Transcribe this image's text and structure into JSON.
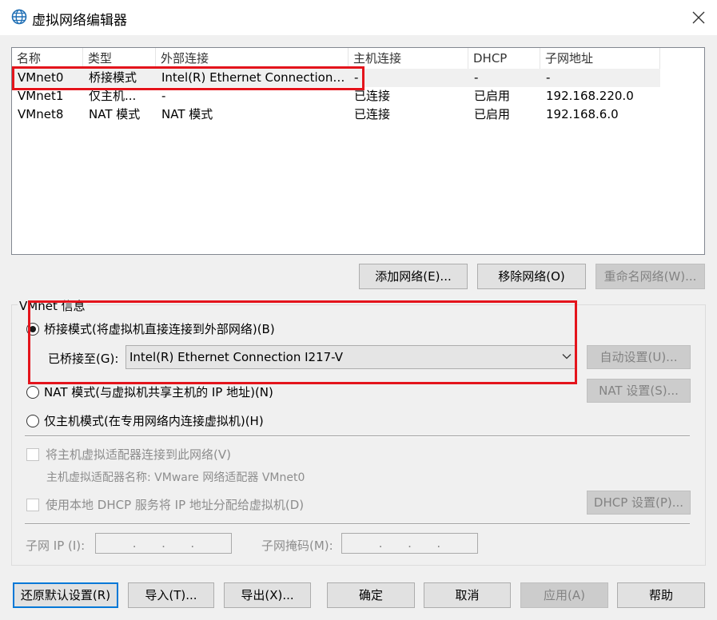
{
  "window": {
    "title": "虚拟网络编辑器"
  },
  "table": {
    "headers": [
      "名称",
      "类型",
      "外部连接",
      "主机连接",
      "DHCP",
      "子网地址"
    ],
    "rows": [
      [
        "VMnet0",
        "桥接模式",
        "Intel(R) Ethernet Connection I...",
        "-",
        "-",
        "-"
      ],
      [
        "VMnet1",
        "仅主机...",
        "-",
        "已连接",
        "已启用",
        "192.168.220.0"
      ],
      [
        "VMnet8",
        "NAT 模式",
        "NAT 模式",
        "已连接",
        "已启用",
        "192.168.6.0"
      ]
    ]
  },
  "network_buttons": {
    "add": "添加网络(E)...",
    "remove": "移除网络(O)",
    "rename": "重命名网络(W)..."
  },
  "vmnet_info": {
    "group_label": "VMnet 信息",
    "bridged_label": "桥接模式(将虚拟机直接连接到外部网络)(B)",
    "bridged_to_label": "已桥接至(G):",
    "bridged_to_value": "Intel(R) Ethernet Connection I217-V",
    "auto_settings": "自动设置(U)...",
    "nat_label": "NAT 模式(与虚拟机共享主机的 IP 地址)(N)",
    "nat_settings": "NAT 设置(S)...",
    "hostonly_label": "仅主机模式(在专用网络内连接虚拟机)(H)",
    "connect_adapter_label": "将主机虚拟适配器连接到此网络(V)",
    "adapter_name_label": "主机虚拟适配器名称: VMware 网络适配器 VMnet0",
    "dhcp_label": "使用本地 DHCP 服务将 IP 地址分配给虚拟机(D)",
    "dhcp_settings": "DHCP 设置(P)...",
    "subnet_ip_label": "子网 IP (I):",
    "subnet_mask_label": "子网掩码(M):",
    "selected_mode": "bridged"
  },
  "footer_buttons": {
    "restore": "还原默认设置(R)",
    "import": "导入(T)...",
    "export": "导出(X)...",
    "ok": "确定",
    "cancel": "取消",
    "apply": "应用(A)",
    "help": "帮助"
  },
  "colors": {
    "highlight": "#e4141c",
    "focus": "#0078d7"
  }
}
